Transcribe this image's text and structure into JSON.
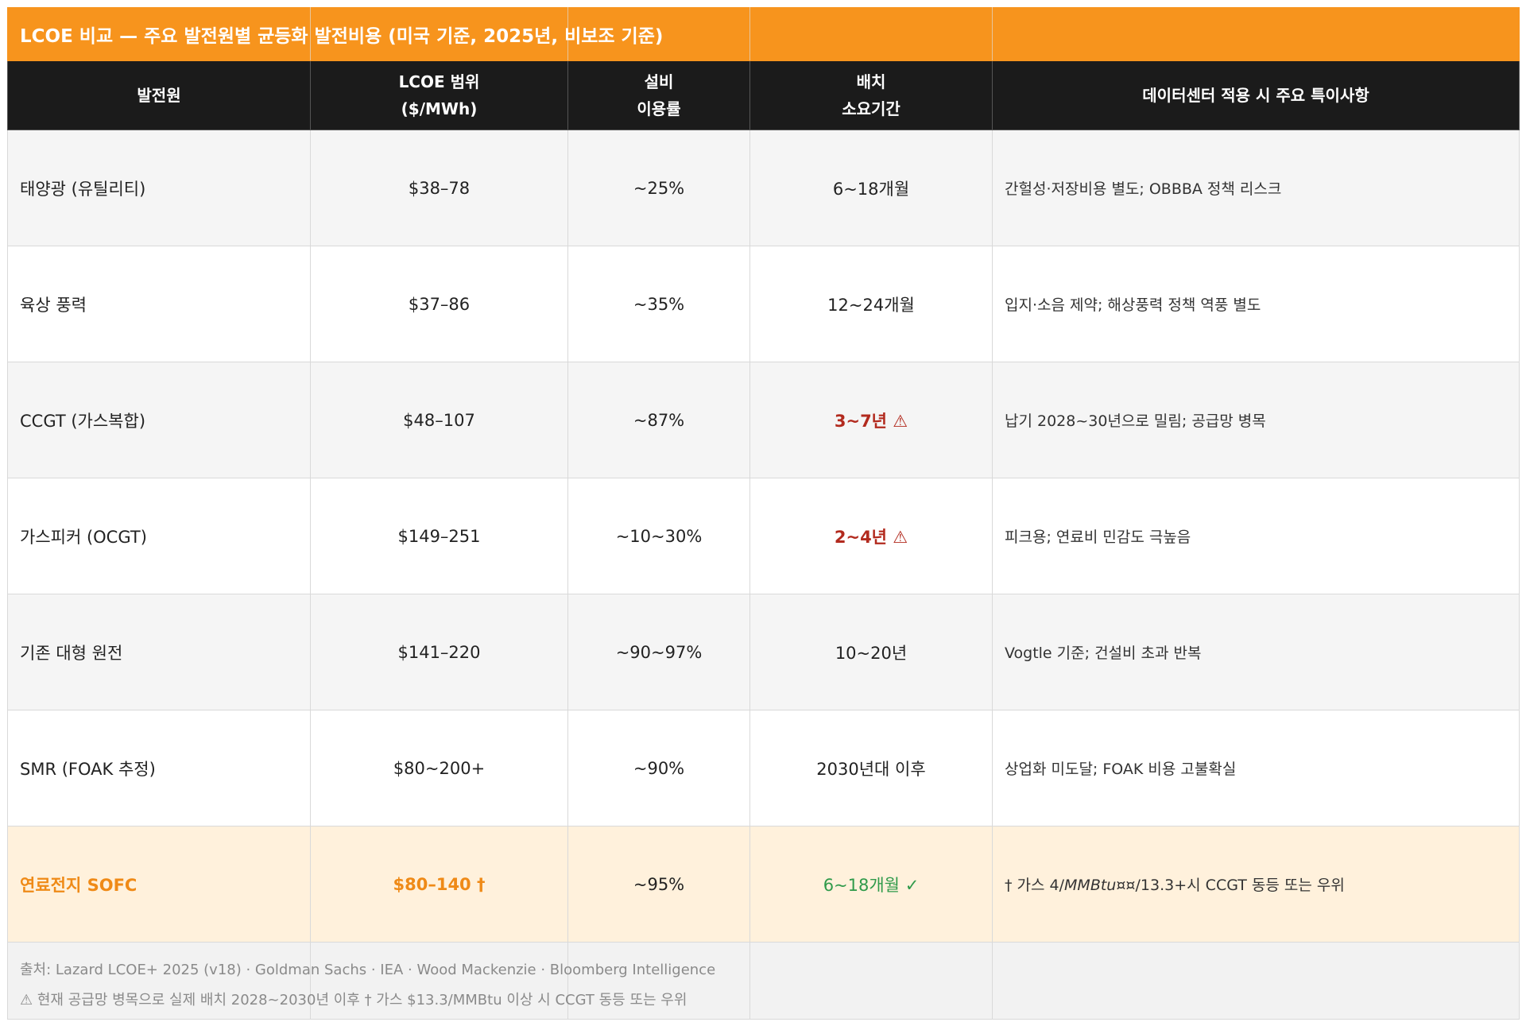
{
  "title": "LCOE 비교 — 주요 발전원별 균등화 발전비용 (미국 기준, 2025년, 비보조 기준)",
  "headers": {
    "source": "발전원",
    "lcoe_line1": "LCOE 범위",
    "lcoe_line2": "($/MWh)",
    "cf_line1": "설비",
    "cf_line2": "이용률",
    "deploy_line1": "배치",
    "deploy_line2": "소요기간",
    "notes": "데이터센터 적용 시 주요 특이사항"
  },
  "rows": [
    {
      "source": "태양광 (유틸리티)",
      "lcoe": "$38–78",
      "cf": "~25%",
      "deploy": "6~18개월",
      "notes": "간헐성·저장비용 별도; OBBBA 정책 리스크"
    },
    {
      "source": "육상 풍력",
      "lcoe": "$37–86",
      "cf": "~35%",
      "deploy": "12~24개월",
      "notes": "입지·소음 제약; 해상풍력 정책 역풍 별도"
    },
    {
      "source": "CCGT (가스복합)",
      "lcoe": "$48–107",
      "cf": "~87%",
      "deploy": "3~7년",
      "deploy_icon": "⚠",
      "notes": "납기 2028~30년으로 밀림; 공급망 병목"
    },
    {
      "source": "가스피커 (OCGT)",
      "lcoe": "$149–251",
      "cf": "~10~30%",
      "deploy": "2~4년",
      "deploy_icon": "⚠",
      "notes": "피크용; 연료비 민감도 극높음"
    },
    {
      "source": "기존 대형 원전",
      "lcoe": "$141–220",
      "cf": "~90~97%",
      "deploy": "10~20년",
      "notes": "Vogtle 기준; 건설비 초과 반복"
    },
    {
      "source": "SMR (FOAK 추정)",
      "lcoe": "$80~200+",
      "cf": "~90%",
      "deploy": "2030년대 이후",
      "notes": "상업화 미도달; FOAK 비용 고불확실"
    },
    {
      "source": "연료전지 SOFC",
      "lcoe": "$80–140",
      "lcoe_mark": "†",
      "cf": "~95%",
      "deploy": "6~18개월",
      "deploy_mark": "✓",
      "notes_prefix": "† 가스 4/",
      "notes_italic": "MMBtu¤¤",
      "notes_suffix": "/13.3+시 CCGT 동등 또는 우위"
    }
  ],
  "footer": {
    "line1": "출처: Lazard LCOE+ 2025 (v18) · Goldman Sachs · IEA · Wood Mackenzie · Bloomberg Intelligence",
    "line2": "⚠ 현재 공급망 병목으로 실제 배치 2028~2030년 이후   † 가스 $13.3/MMBtu 이상 시 CCGT 동등 또는 우위"
  },
  "colors": {
    "title_bg": "#f7941d",
    "header_bg": "#1b1b1b",
    "warning": "#b22a1e",
    "highlight_text": "#ef8a17",
    "highlight_bg": "#fff1dc",
    "check_green": "#2f9a4a"
  }
}
